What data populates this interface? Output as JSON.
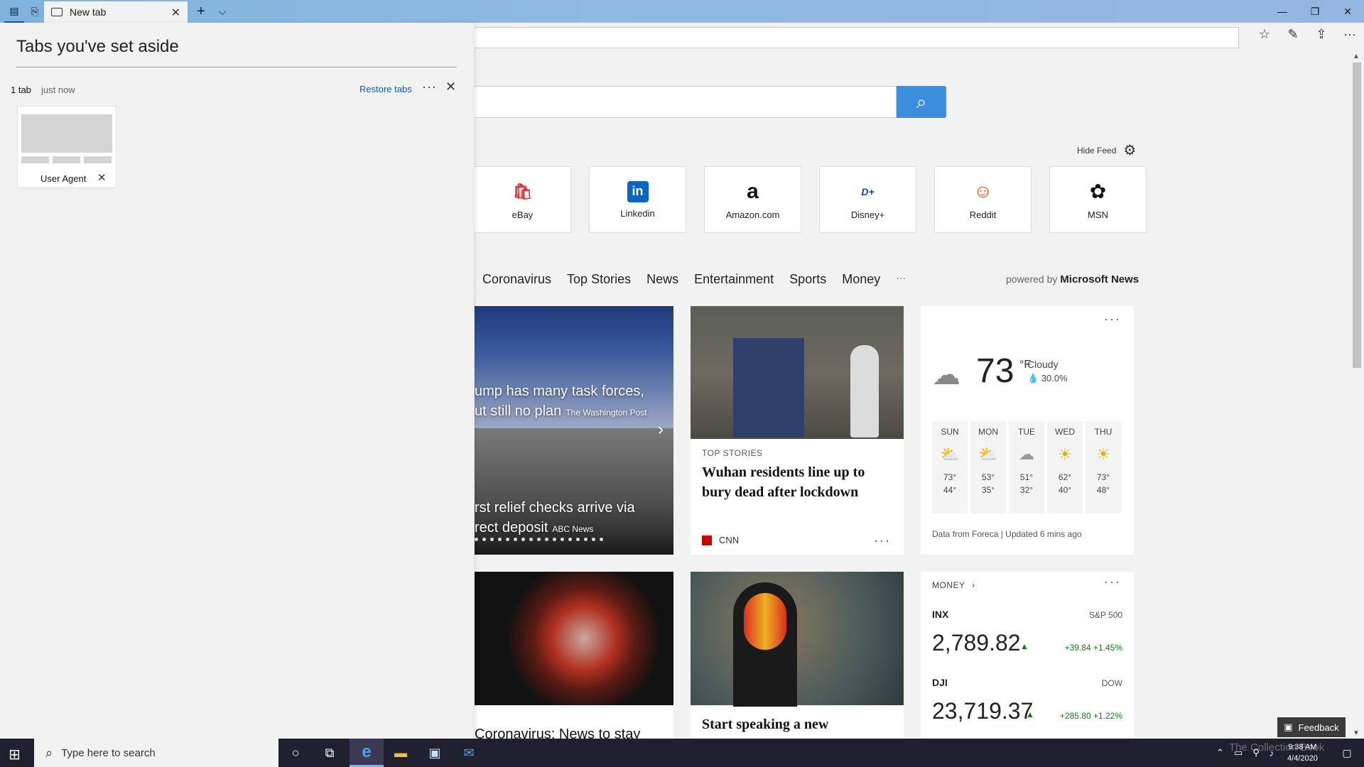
{
  "window": {
    "tab_title": "New tab",
    "new_tab_symbol": "+",
    "tab_list_symbol": "⌵",
    "close_tab_symbol": "✕",
    "minimize_symbol": "—",
    "restore_symbol": "❐",
    "close_symbol": "✕"
  },
  "toolbar": {
    "favorites_symbol": "☆",
    "notes_symbol": "✎",
    "share_symbol": "⇪",
    "more_symbol": "···"
  },
  "aside": {
    "title": "Tabs you've set aside",
    "count": "1 tab",
    "time": "just now",
    "restore_label": "Restore tabs",
    "more_symbol": "···",
    "close_symbol": "✕",
    "item_label": "User Agent",
    "item_close_symbol": "✕"
  },
  "search": {
    "button_symbol": "⌕"
  },
  "feed": {
    "hide_feed_label": "Hide Feed",
    "gear_symbol": "⚙",
    "powered_prefix": "powered by",
    "powered_brand": "Microsoft News",
    "nav": [
      "Coronavirus",
      "Top Stories",
      "News",
      "Entertainment",
      "Sports",
      "Money",
      "···"
    ]
  },
  "tiles": [
    {
      "label": "eBay",
      "logo": "🛍",
      "color": "#e53238"
    },
    {
      "label": "Linkedin",
      "logo": "in",
      "color": "#0a66c2"
    },
    {
      "label": "Amazon.com",
      "logo": "a",
      "color": "#111111"
    },
    {
      "label": "Disney+",
      "logo": "D+",
      "color": "#113ccf"
    },
    {
      "label": "Reddit",
      "logo": "☺",
      "color": "#ff4500"
    },
    {
      "label": "MSN",
      "logo": "✿",
      "color": "#111111"
    }
  ],
  "hero": {
    "story1_line1": "ump has many task forces,",
    "story1_line2": "ut still no plan",
    "story1_source": "The Washington Post",
    "story2_line1": "rst relief checks arrive via",
    "story2_line2": "rect deposit",
    "story2_source": "ABC News",
    "arrow_symbol": "›"
  },
  "story_card": {
    "tag": "TOP STORIES",
    "headline": "Wuhan residents line up to bury dead after lockdown",
    "source": "CNN",
    "more_symbol": "···"
  },
  "weather": {
    "temp": "73",
    "unit": "°F",
    "condition": "Cloudy",
    "precip": "💧 30.0%",
    "more_symbol": "···",
    "cloud_symbol": "☁",
    "footer": "Data from Foreca | Updated 6 mins ago",
    "forecast": [
      {
        "day": "SUN",
        "icon": "⛅",
        "high": "73°",
        "low": "44°"
      },
      {
        "day": "MON",
        "icon": "⛅",
        "high": "53°",
        "low": "35°"
      },
      {
        "day": "TUE",
        "icon": "☁",
        "high": "51°",
        "low": "32°"
      },
      {
        "day": "WED",
        "icon": "☀",
        "high": "62°",
        "low": "40°"
      },
      {
        "day": "THU",
        "icon": "☀",
        "high": "73°",
        "low": "48°"
      }
    ]
  },
  "money": {
    "label": "MONEY",
    "chevron": "›",
    "more_symbol": "···",
    "up_symbol": "▲",
    "inx": {
      "ticker": "INX",
      "name": "S&P 500",
      "price": "2,789.82",
      "change": "+39.84 +1.45%"
    },
    "dji": {
      "ticker": "DJI",
      "name": "DOW",
      "price": "23,719.37",
      "change": "+285.80 +1.22%"
    }
  },
  "bottom": {
    "story3_title": "Coronavirus: News to stay",
    "story4_title": "Start speaking a new"
  },
  "feedback": {
    "icon_symbol": "▣",
    "label": "Feedback"
  },
  "taskbar": {
    "start_symbol": "⊞",
    "search_symbol": "⌕",
    "search_placeholder": "Type here to search",
    "cortana_symbol": "○",
    "taskview_symbol": "⧉",
    "edge_symbol": "e",
    "explorer_symbol": "▬",
    "store_symbol": "▣",
    "mail_symbol": "✉",
    "tray_up_symbol": "⌃",
    "tray_network_symbol": "▭",
    "tray_wifi_symbol": "⚲",
    "tray_volume_symbol": "♪",
    "notification_symbol": "▢",
    "time": "9:38 AM",
    "date": "4/4/2020",
    "watermark": "The Collection Book"
  },
  "colors": {
    "search_button": "#3a8edc",
    "link": "#0063b1",
    "positive": "#107c10",
    "taskbar": "#1f1f2e"
  }
}
